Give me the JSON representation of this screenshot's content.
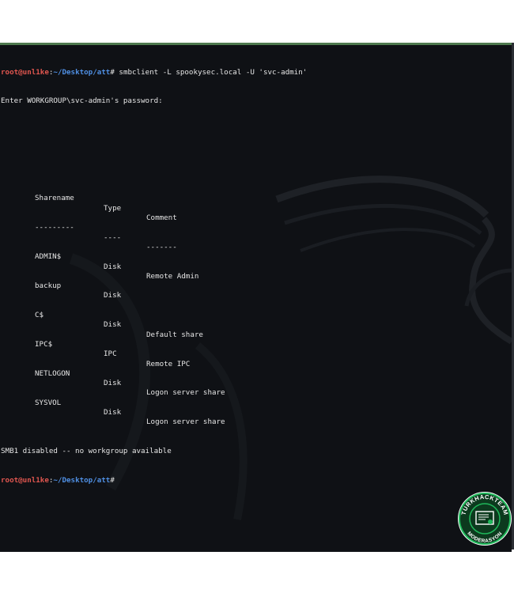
{
  "terminal": {
    "prompt": {
      "user_host": "root@unl1ke",
      "sep": ":",
      "path": "~/Desktop/att",
      "symbol": "#"
    },
    "command": " smbclient -L spookysec.local -U 'svc-admin'",
    "password_prompt": "Enter WORKGROUP\\svc-admin's password:",
    "table": {
      "headers": [
        "Sharename",
        "Type",
        "Comment"
      ],
      "separators": [
        "---------",
        "----",
        "-------"
      ],
      "rows": [
        [
          "ADMIN$",
          "Disk",
          "Remote Admin"
        ],
        [
          "backup",
          "Disk",
          ""
        ],
        [
          "C$",
          "Disk",
          "Default share"
        ],
        [
          "IPC$",
          "IPC",
          "Remote IPC"
        ],
        [
          "NETLOGON",
          "Disk",
          "Logon server share"
        ],
        [
          "SYSVOL",
          "Disk",
          "Logon server share"
        ]
      ]
    },
    "status_line": "SMB1 disabled -- no workgroup available"
  },
  "badge": {
    "top_text": "TURKHACKTEAM",
    "bottom_text": "MODERASYON",
    "icon": "certificate-icon",
    "color": "#1fb85a"
  },
  "colors": {
    "background": "#0f1115",
    "user": "#e0564f",
    "path": "#4f8fe3",
    "text": "#e6e6e6",
    "accent_border": "#4f7a4f"
  }
}
